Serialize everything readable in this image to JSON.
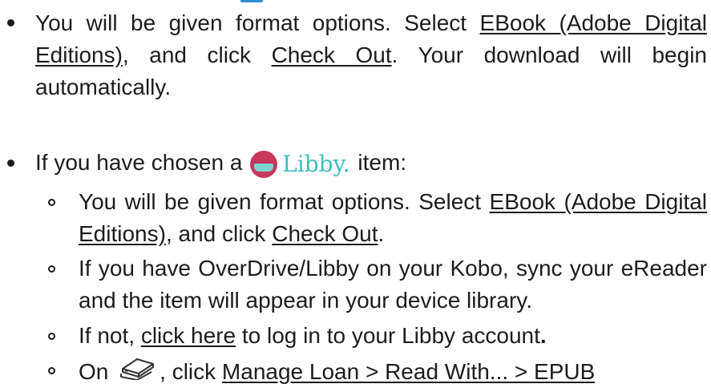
{
  "item1": {
    "t1": "You will be given format options. Select ",
    "link1": "EBook (Adobe Digital Editions)",
    "t2": ", and click ",
    "link2": "Check Out",
    "t3": ". Your download will begin automatically."
  },
  "item2": {
    "t1": "If you have chosen a ",
    "logo_text": "Libby.",
    "t2": " item:"
  },
  "sub1": {
    "t1": "You will be given format options. Select ",
    "link1": "EBook (Adobe Digital Editions)",
    "t2": ", and click ",
    "link2": "Check Out",
    "t3": "."
  },
  "sub2": {
    "text": "If you have OverDrive/Libby on your Kobo, sync your eReader and the item will appear in your device library."
  },
  "sub3": {
    "t1": "If not, ",
    "link": "click here",
    "t2": " to log in to your Libby account",
    "t3": "."
  },
  "sub4": {
    "t1": "On ",
    "t2": ", click ",
    "link": "Manage Loan > Read With... > EPUB"
  },
  "icons": {
    "libby_logo": "libby-logo-icon",
    "bookshelf": "bookshelf-icon"
  },
  "colors": {
    "libby_red": "#c8385a",
    "libby_teal": "#3bbfbf",
    "text": "#1c1c1c"
  }
}
